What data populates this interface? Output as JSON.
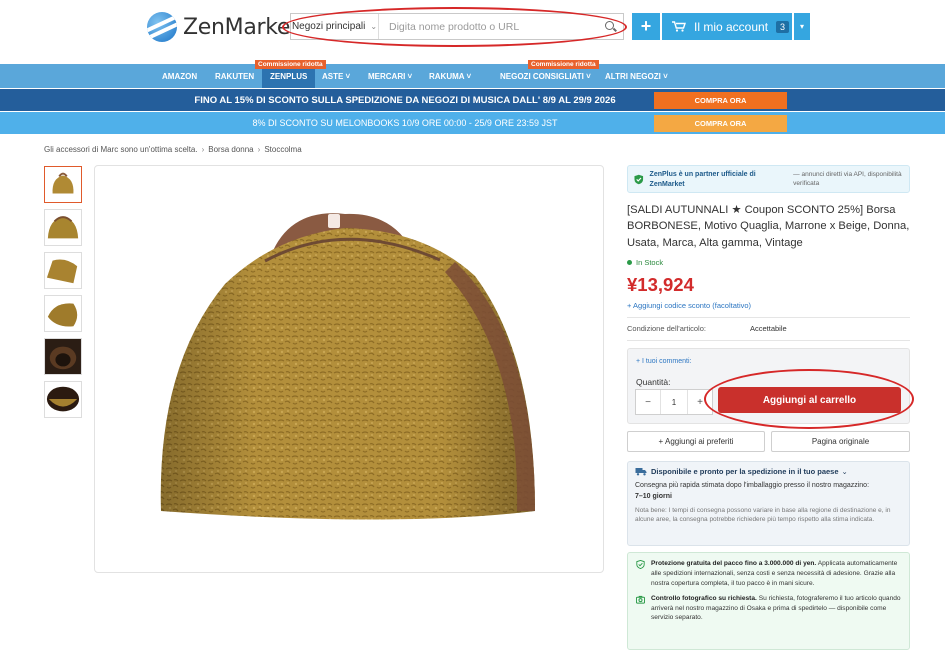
{
  "header": {
    "logo_text": "ZenMarket",
    "search": {
      "scope": "Negozi principali",
      "placeholder": "Digita nome prodotto o URL"
    },
    "plus_label": "+",
    "account_label": "Il mio account",
    "cart_count": "3"
  },
  "nav": {
    "items": [
      {
        "label": "AMAZON"
      },
      {
        "label": "RAKUTEN"
      },
      {
        "label": "ZENPLUS",
        "tag": "Commissione ridotta"
      },
      {
        "label": "ASTE ˅"
      },
      {
        "label": "MERCARI ˅"
      },
      {
        "label": "RAKUMA ˅"
      },
      {
        "label": "NEGOZI CONSIGLIATI ˅",
        "tag": "Commissione ridotta"
      },
      {
        "label": "ALTRI NEGOZI ˅"
      }
    ]
  },
  "promos": [
    {
      "text": "FINO AL 15% DI SCONTO SULLA SPEDIZIONE DA NEGOZI DI MUSICA DALL' 8/9 AL 29/9 2026",
      "button": "COMPRA ORA"
    },
    {
      "text": "8% DI SCONTO SU MELONBOOKS 10/9 ORE 00:00 - 25/9 ORE 23:59 JST",
      "button": "COMPRA ORA"
    }
  ],
  "breadcrumb": [
    "Gli accessori di Marc sono un'ottima scelta.",
    "Borsa donna",
    "Stoccolma"
  ],
  "product": {
    "partner_main": "ZenPlus è un partner ufficiale di ZenMarket",
    "partner_note": "— annunci diretti via API, disponibilità verificata",
    "title": "[SALDI AUTUNNALI ★ Coupon SCONTO 25%] Borsa BORBONESE, Motivo Quaglia, Marrone x Beige, Donna, Usata, Marca, Alta gamma, Vintage",
    "stock": "In Stock",
    "price": "¥13,924",
    "discount_link": "+ Aggiungi codice sconto (facoltativo)",
    "condition_label": "Condizione dell'articolo:",
    "condition_value": "Accettabile",
    "comments_link": "+ I tuoi commenti:",
    "quantity_label": "Quantità:",
    "quantity": "1",
    "add_to_cart": "Aggiungi al carrello",
    "add_favorites": "+ Aggiungi ai preferiti",
    "original_page": "Pagina originale"
  },
  "shipping": {
    "head": "Disponibile e pronto per la spedizione in il tuo paese",
    "body_prefix": "Consegna più rapida stimata dopo l'imballaggio presso il nostro magazzino:",
    "body_days": "7–10 giorni",
    "note": "Nota bene: I tempi di consegna possono variare in base alla regione di destinazione e, in alcune aree, la consegna potrebbe richiedere più tempo rispetto alla stima indicata."
  },
  "protection": {
    "row1_bold": "Protezione gratuita del pacco fino a 3.000.000 di yen.",
    "row1_text": "Applicata automaticamente alle spedizioni internazionali, senza costi e senza necessità di adesione. Grazie alla nostra copertura completa, il tuo pacco è in mani sicure.",
    "row2_bold": "Controllo fotografico su richiesta.",
    "row2_text": "Su richiesta, fotograferemo il tuo articolo quando arriverà nel nostro magazzino di Osaka e prima di spedirtelo — disponibile come servizio separato."
  },
  "colors": {
    "accent_blue": "#35a6e0",
    "nav_blue": "#5aa7da",
    "price_red": "#d22b2b",
    "cart_red": "#c9302c",
    "annotation_red": "#d62828"
  }
}
